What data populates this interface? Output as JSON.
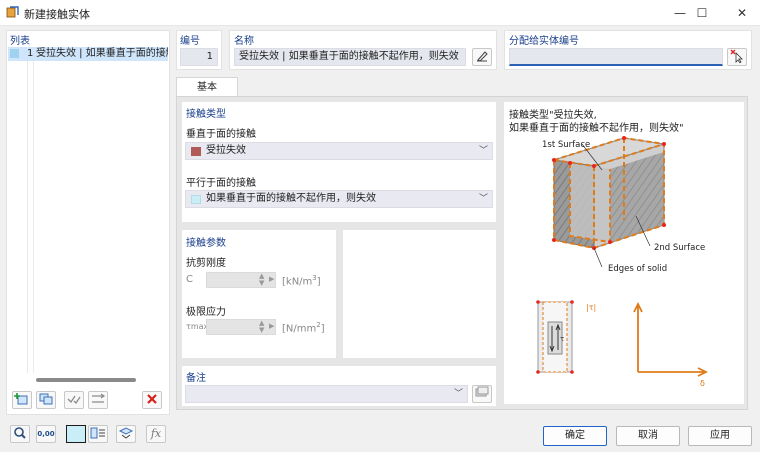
{
  "window": {
    "title": "新建接触实体",
    "minimize_icon": "—",
    "maximize_icon": "☐",
    "close_icon": "✕"
  },
  "list": {
    "title": "列表",
    "items": [
      {
        "number": "1",
        "label": "受拉失效 | 如果垂直于面的接触"
      }
    ]
  },
  "header": {
    "number_label": "编号",
    "number_value": "1",
    "name_label": "名称",
    "name_value": "受拉失效 | 如果垂直于面的接触不起作用，则失效",
    "assign_label": "分配给实体编号",
    "assign_value": ""
  },
  "tabs": [
    {
      "label": "基本"
    }
  ],
  "contact_type": {
    "section_title": "接触类型",
    "perpendicular_label": "垂直于面的接触",
    "perpendicular_value": "受拉失效",
    "perpendicular_color": "#b05a5a",
    "parallel_label": "平行于面的接触",
    "parallel_value": "如果垂直于面的接触不起作用，则失效",
    "parallel_color": "#c9eef7"
  },
  "contact_params": {
    "section_title": "接触参数",
    "shear_label": "抗剪刚度",
    "shear_symbol": "C",
    "shear_unit": "[kN/m",
    "shear_unit_sup": "3",
    "shear_unit_end": "]",
    "limit_label": "极限应力",
    "limit_symbol": "τmax",
    "limit_unit": "[N/mm",
    "limit_unit_sup": "2",
    "limit_unit_end": "]"
  },
  "comment": {
    "label": "备注",
    "value": ""
  },
  "preview": {
    "caption_line1": "接触类型\"受拉失效,",
    "caption_line2": "如果垂直于面的接触不起作用，则失效\"",
    "label_surface1": "1st Surface",
    "label_surface2": "2nd Surface",
    "label_edges": "Edges of solid",
    "label_tau": "|τ|",
    "label_tau_small": "τ",
    "label_delta": "δ",
    "accent_color": "#e07b1a"
  },
  "footer": {
    "ok_label": "确定",
    "cancel_label": "取消",
    "apply_label": "应用",
    "units_icon_text": "0,00",
    "fx_icon_text": "fx"
  }
}
